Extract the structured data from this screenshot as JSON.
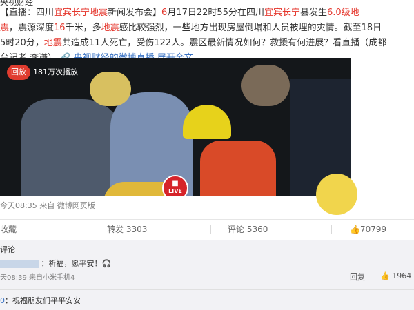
{
  "post": {
    "top_cut": "央视财经",
    "line1": [
      {
        "t": "【直播：四川",
        "c": ""
      },
      {
        "t": "宜宾长宁地震",
        "c": "red"
      },
      {
        "t": "新闻发布会】",
        "c": ""
      },
      {
        "t": "6",
        "c": "red"
      },
      {
        "t": "月17日22时55分在四川",
        "c": ""
      },
      {
        "t": "宜宾长宁",
        "c": "red"
      },
      {
        "t": "县发生",
        "c": ""
      },
      {
        "t": "6.0级地",
        "c": "red"
      }
    ],
    "line2": [
      {
        "t": "震",
        "c": "red"
      },
      {
        "t": "，震源深度",
        "c": ""
      },
      {
        "t": "16",
        "c": "red"
      },
      {
        "t": "千米，多",
        "c": ""
      },
      {
        "t": "地震",
        "c": "red"
      },
      {
        "t": "感比较强烈，一些地方出现房屋倒塌和人员被埋的灾情。截至18日",
        "c": ""
      }
    ],
    "line3": [
      {
        "t": "5时20分，",
        "c": ""
      },
      {
        "t": "地震",
        "c": "red"
      },
      {
        "t": "共造成11人死亡，受伤122人。震区最新情况如何？救援有何进展？看直播（成都",
        "c": ""
      }
    ],
    "line4_prefix": "台记者 李谦）",
    "live_link": "央视财经的微博直播",
    "expand": "展开全文",
    "expand_arrow": "⌄"
  },
  "video": {
    "replay_tag": "回放",
    "views": "181万次播放",
    "live_label": "LIVE",
    "live_icon": "camera-icon"
  },
  "meta": "今天08:35 来自 微博网页版",
  "actions": {
    "favorite": "收藏",
    "repost": "转发 3303",
    "comment": "评论 5360",
    "like": "70799",
    "like_icon": "thumbs-up-icon"
  },
  "comments": {
    "title": "评论",
    "c1": {
      "text": "：祈福，愿平安！🎧",
      "meta": "天08:39 来自小米手机4",
      "reply": "回复",
      "likes": "1964"
    },
    "c2": {
      "user": "0",
      "text": "：祝福朋友们平平安安"
    }
  }
}
